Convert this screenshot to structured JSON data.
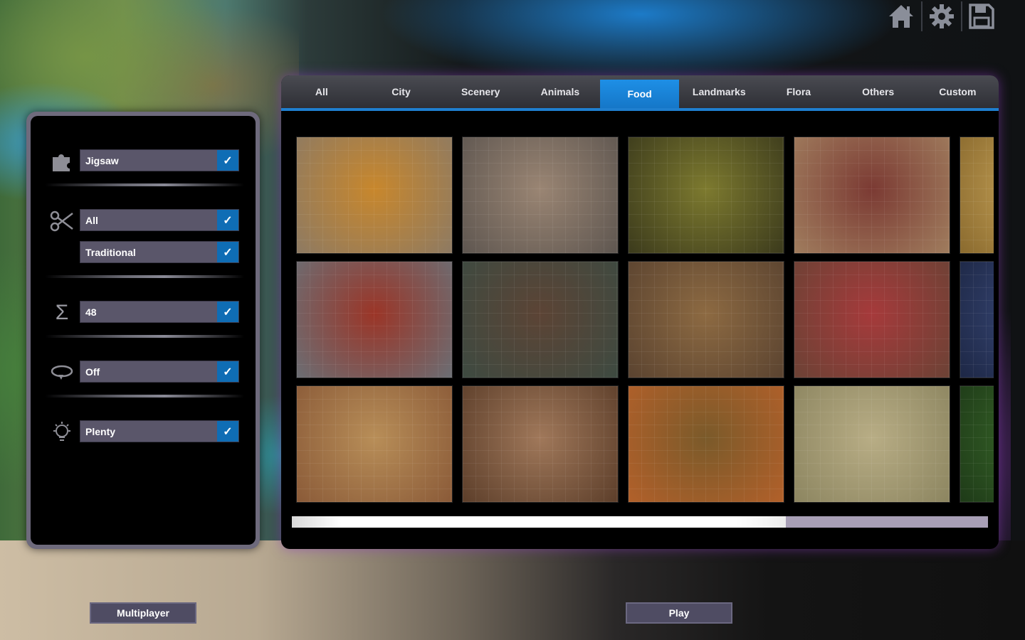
{
  "top_icons": [
    {
      "name": "home-icon",
      "glyph": "⌂"
    },
    {
      "name": "gear-icon",
      "glyph": "⚙"
    },
    {
      "name": "save-icon",
      "glyph": "💾"
    }
  ],
  "options": {
    "puzzle_type": {
      "icon": "puzzle-piece-icon",
      "value": "Jigsaw"
    },
    "cut_category": {
      "icon": "scissors-icon",
      "value": "All"
    },
    "cut_style": {
      "value": "Traditional"
    },
    "piece_count": {
      "icon": "sigma-icon",
      "value": "48"
    },
    "rotation": {
      "icon": "rotate-icon",
      "value": "Off"
    },
    "hints": {
      "icon": "lightbulb-icon",
      "value": "Plenty"
    }
  },
  "tabs": [
    {
      "label": "All"
    },
    {
      "label": "City"
    },
    {
      "label": "Scenery"
    },
    {
      "label": "Animals"
    },
    {
      "label": "Food",
      "active": true
    },
    {
      "label": "Landmarks"
    },
    {
      "label": "Flora"
    },
    {
      "label": "Others"
    },
    {
      "label": "Custom"
    }
  ],
  "thumbnails": [
    {
      "name": "poutine",
      "colors": [
        "#c8872c",
        "#8d7a63"
      ]
    },
    {
      "name": "flatbread-dessert",
      "colors": [
        "#9a8573",
        "#5e5650"
      ]
    },
    {
      "name": "pickled-jars",
      "colors": [
        "#7d7a2f",
        "#3b3a1c"
      ]
    },
    {
      "name": "maple-syrup-spoon",
      "colors": [
        "#7b3a33",
        "#a07d5e"
      ]
    },
    {
      "name": "partial-1",
      "colors": [
        "#c9a55a",
        "#8a6a2e"
      ]
    },
    {
      "name": "lobsters",
      "colors": [
        "#9b3527",
        "#6b6e74"
      ]
    },
    {
      "name": "nanaimo-bars",
      "colors": [
        "#5c4435",
        "#3d4a41"
      ]
    },
    {
      "name": "butter-tart",
      "colors": [
        "#8d6a42",
        "#5a4330"
      ]
    },
    {
      "name": "jam-jars",
      "colors": [
        "#a63a3b",
        "#6b4235"
      ]
    },
    {
      "name": "partial-2",
      "colors": [
        "#3a4a7a",
        "#1d2745"
      ]
    },
    {
      "name": "bread-ham",
      "colors": [
        "#b88e58",
        "#8a5a38"
      ]
    },
    {
      "name": "donuts",
      "colors": [
        "#a0785a",
        "#5c3e2a"
      ]
    },
    {
      "name": "pumpkins",
      "colors": [
        "#7a5a2a",
        "#b2602a"
      ]
    },
    {
      "name": "cheese-curds",
      "colors": [
        "#b8ad85",
        "#8c8560"
      ]
    },
    {
      "name": "partial-3",
      "colors": [
        "#3a6a2a",
        "#1e3a18"
      ]
    }
  ],
  "scroll": {
    "position": 0.71
  },
  "buttons": {
    "multiplayer": "Multiplayer",
    "play": "Play"
  },
  "colors": {
    "accent": "#1f7fcf",
    "button_bg": "#4f4c63",
    "scroll_track": "#a89fb6"
  }
}
